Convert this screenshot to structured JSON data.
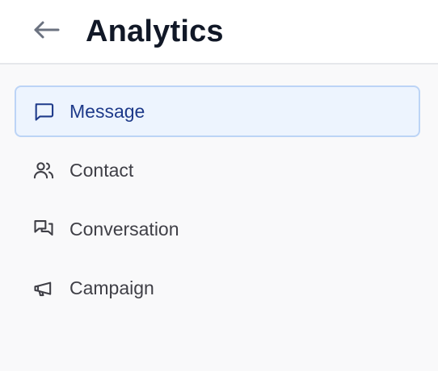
{
  "header": {
    "title": "Analytics",
    "back_icon": "arrow-left-icon"
  },
  "sidebar": {
    "items": [
      {
        "label": "Message",
        "icon": "message-square-icon",
        "active": true
      },
      {
        "label": "Contact",
        "icon": "users-icon",
        "active": false
      },
      {
        "label": "Conversation",
        "icon": "messages-icon",
        "active": false
      },
      {
        "label": "Campaign",
        "icon": "megaphone-icon",
        "active": false
      }
    ]
  },
  "colors": {
    "active_bg": "#edf4fe",
    "active_border": "#bcd4f6",
    "active_text": "#1e3a8a",
    "text": "#3f3f46",
    "title": "#111827"
  }
}
